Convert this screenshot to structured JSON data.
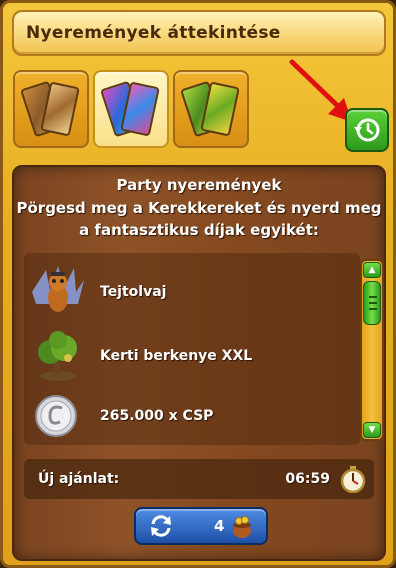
{
  "window": {
    "title": "Nyeremények áttekintése"
  },
  "tabs": [
    {
      "icon": "ticket-tab-icon-1",
      "active": false
    },
    {
      "icon": "ticket-tab-icon-2",
      "active": true
    },
    {
      "icon": "ticket-tab-icon-3",
      "active": false
    }
  ],
  "history_button": {
    "icon": "history-icon"
  },
  "prizes": {
    "heading": "Party nyeremények",
    "description_line1": "Pörgesd meg a Kerekkereket és nyerd meg",
    "description_line2": "a fantasztikus díjak egyikét:",
    "items": [
      {
        "label": "Tejtolvaj",
        "icon": "fox-creature-icon"
      },
      {
        "label": "Kerti berkenye XXL",
        "icon": "tree-plant-icon"
      },
      {
        "label": "265.000 x CSP",
        "icon": "silver-coin-icon"
      }
    ]
  },
  "offer": {
    "label": "Új ajánlat:",
    "time": "06:59",
    "icon": "stopwatch-icon"
  },
  "refresh": {
    "count": "4",
    "icon": "refresh-icon",
    "currency_icon": "coin-pot-icon"
  },
  "colors": {
    "accent_green": "#2e9a1c",
    "wood": "#8e5228",
    "gold": "#f4c73a",
    "blue_button": "#1f4fa6"
  }
}
